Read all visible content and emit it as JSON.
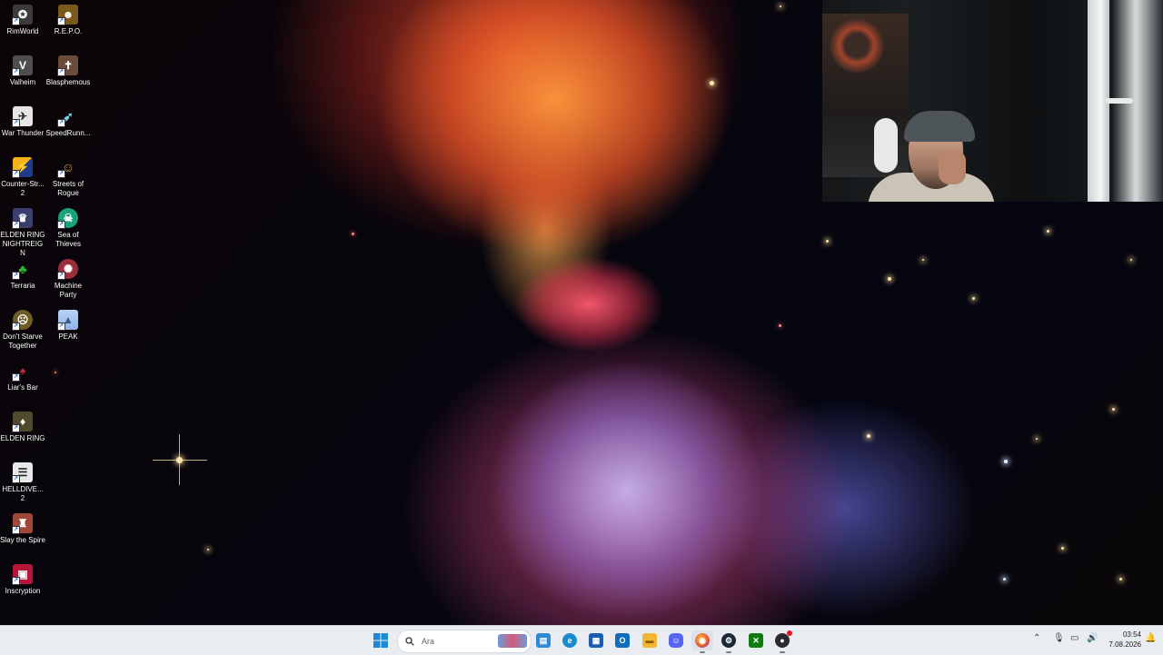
{
  "desktop_icons": [
    {
      "label": "RimWorld",
      "icon": "rimworld-icon",
      "color": "#3b3b3b",
      "glyph": "✪"
    },
    {
      "label": "R.E.P.O.",
      "icon": "repo-icon",
      "color": "#7a5a1c",
      "glyph": "☻"
    },
    {
      "label": "Valheim",
      "icon": "valheim-icon",
      "color": "#4e4e4e",
      "glyph": "V"
    },
    {
      "label": "Blasphemous",
      "icon": "blasphemous-icon",
      "color": "#6b4a3a",
      "glyph": "✝"
    },
    {
      "label": "War Thunder",
      "icon": "war-thunder-icon",
      "color": "#e6e6e6",
      "glyph": "✈"
    },
    {
      "label": "SpeedRunn...",
      "icon": "speedrunners-icon",
      "color": "#27445e",
      "glyph": "➶"
    },
    {
      "label": "Counter-Str... 2",
      "icon": "counter-strike-icon",
      "color": "#1e3a8a",
      "glyph": "⚡"
    },
    {
      "label": "Streets of Rogue",
      "icon": "streets-of-rogue-icon",
      "color": "#2c2c2c",
      "glyph": "☺"
    },
    {
      "label": "ELDEN RING NIGHTREIGN",
      "icon": "nightreign-icon",
      "color": "#3b3f6e",
      "glyph": "♛"
    },
    {
      "label": "Sea of Thieves",
      "icon": "sea-of-thieves-icon",
      "color": "#1aa37a",
      "glyph": "☠"
    },
    {
      "label": "Terraria",
      "icon": "terraria-icon",
      "color": "#2d8a2f",
      "glyph": "♣"
    },
    {
      "label": "Machine Party",
      "icon": "machine-party-icon",
      "color": "#9a2f3b",
      "glyph": "✺"
    },
    {
      "label": "Don't Starve Together",
      "icon": "dont-starve-icon",
      "color": "#6f5a2a",
      "glyph": "☹"
    },
    {
      "label": "PEAK",
      "icon": "peak-icon",
      "color": "#8fb3e8",
      "glyph": "▲"
    },
    {
      "label": "Liar's Bar",
      "icon": "liars-bar-icon",
      "color": "#2a0f12",
      "glyph": "♠"
    },
    {
      "label": "ELDEN RING",
      "icon": "elden-ring-icon",
      "color": "#4f4a2a",
      "glyph": "♦"
    },
    {
      "label": "HELLDIVE... 2",
      "icon": "helldivers-icon",
      "color": "#e8e8e8",
      "glyph": "☰"
    },
    {
      "label": "Slay the Spire",
      "icon": "slay-the-spire-icon",
      "color": "#a0463a",
      "glyph": "♜"
    },
    {
      "label": "Inscryption",
      "icon": "inscryption-icon",
      "color": "#b5163a",
      "glyph": "▣"
    }
  ],
  "taskbar": {
    "search_placeholder": "Ara",
    "pinned": [
      {
        "name": "file-manager-icon",
        "color": "#2f8ad6",
        "glyph": "▤"
      },
      {
        "name": "edge-icon",
        "color": "#1b8bd1",
        "glyph": "e"
      },
      {
        "name": "store-icon",
        "color": "#1a5fb4",
        "glyph": "▦"
      },
      {
        "name": "outlook-icon",
        "color": "#0f6cbd",
        "glyph": "O"
      },
      {
        "name": "folder-icon",
        "color": "#f2b632",
        "glyph": "▬"
      },
      {
        "name": "discord-icon",
        "color": "#5865f2",
        "glyph": "☺"
      },
      {
        "name": "firefox-icon",
        "color": "#e8602c",
        "glyph": "◉"
      },
      {
        "name": "steam-icon",
        "color": "#1b2838",
        "glyph": "⚙"
      },
      {
        "name": "xbox-icon",
        "color": "#107c10",
        "glyph": "✕"
      },
      {
        "name": "obs-icon",
        "color": "#2b2b2b",
        "glyph": "●"
      }
    ],
    "clock_time": "03:54",
    "clock_date": "7.08.2026"
  }
}
